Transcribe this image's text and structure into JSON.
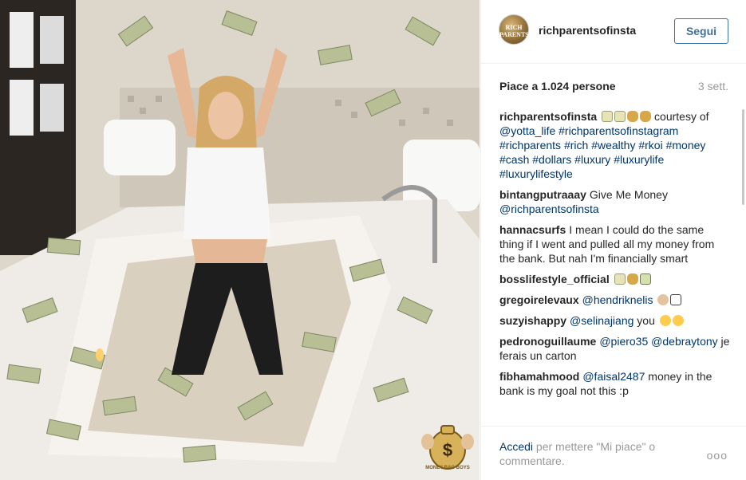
{
  "header": {
    "avatar_text": "RICH PARENTS",
    "username": "richparentsofinsta",
    "follow_label": "Segui"
  },
  "meta": {
    "likes": "Piace a 1.024 persone",
    "time": "3 sett."
  },
  "photo": {
    "watermark": "MONEY BAG BOYS"
  },
  "comments": [
    {
      "user": "richparentsofinsta",
      "parts": [
        {
          "type": "emoji",
          "icon": "money-with-wings"
        },
        {
          "type": "emoji",
          "icon": "money-with-wings"
        },
        {
          "type": "emoji",
          "icon": "money-bag"
        },
        {
          "type": "emoji",
          "icon": "money-bag"
        },
        {
          "type": "text",
          "text": " courtesy of "
        },
        {
          "type": "link",
          "text": "@yotta_life"
        },
        {
          "type": "text",
          "text": " "
        },
        {
          "type": "link",
          "text": "#richparentsofinstagram"
        },
        {
          "type": "text",
          "text": " "
        },
        {
          "type": "link",
          "text": "#richparents"
        },
        {
          "type": "text",
          "text": " "
        },
        {
          "type": "link",
          "text": "#rich"
        },
        {
          "type": "text",
          "text": " "
        },
        {
          "type": "link",
          "text": "#wealthy"
        },
        {
          "type": "text",
          "text": " "
        },
        {
          "type": "link",
          "text": "#rkoi"
        },
        {
          "type": "text",
          "text": " "
        },
        {
          "type": "link",
          "text": "#money"
        },
        {
          "type": "text",
          "text": " "
        },
        {
          "type": "link",
          "text": "#cash"
        },
        {
          "type": "text",
          "text": " "
        },
        {
          "type": "link",
          "text": "#dollars"
        },
        {
          "type": "text",
          "text": " "
        },
        {
          "type": "link",
          "text": "#luxury"
        },
        {
          "type": "text",
          "text": " "
        },
        {
          "type": "link",
          "text": "#luxurylife"
        },
        {
          "type": "text",
          "text": " "
        },
        {
          "type": "link",
          "text": "#luxurylifestyle"
        }
      ]
    },
    {
      "user": "bintangputraaay",
      "parts": [
        {
          "type": "text",
          "text": "Give Me Money "
        },
        {
          "type": "link",
          "text": "@richparentsofinsta"
        }
      ]
    },
    {
      "user": "hannacsurfs",
      "parts": [
        {
          "type": "text",
          "text": "I mean I could do the same thing if I went and pulled all my money from the bank. But nah I'm financially smart"
        }
      ]
    },
    {
      "user": "bosslifestyle_official",
      "parts": [
        {
          "type": "emoji",
          "icon": "money-with-wings"
        },
        {
          "type": "emoji",
          "icon": "money-bag"
        },
        {
          "type": "emoji",
          "icon": "dollar-banknote"
        }
      ]
    },
    {
      "user": "gregoirelevaux",
      "parts": [
        {
          "type": "link",
          "text": "@hendriknelis"
        },
        {
          "type": "text",
          "text": " "
        },
        {
          "type": "emoji",
          "icon": "ok-hand"
        },
        {
          "type": "emoji",
          "icon": "abacus"
        }
      ]
    },
    {
      "user": "suzyishappy",
      "parts": [
        {
          "type": "link",
          "text": "@selinajiang"
        },
        {
          "type": "text",
          "text": " you "
        },
        {
          "type": "emoji",
          "icon": "tears-of-joy"
        },
        {
          "type": "emoji",
          "icon": "tears-of-joy"
        }
      ]
    },
    {
      "user": "pedronoguillaume",
      "parts": [
        {
          "type": "link",
          "text": "@piero35"
        },
        {
          "type": "text",
          "text": " "
        },
        {
          "type": "link",
          "text": "@debraytony"
        },
        {
          "type": "text",
          "text": " je ferais un carton"
        }
      ]
    },
    {
      "user": "fibhamahmood",
      "parts": [
        {
          "type": "link",
          "text": "@faisal2487"
        },
        {
          "type": "text",
          "text": " money in the bank is my goal not this :p"
        }
      ]
    }
  ],
  "footer": {
    "login_link": "Accedi",
    "login_rest": " per mettere \"Mi piace\" o commentare.",
    "more": "ooo"
  }
}
